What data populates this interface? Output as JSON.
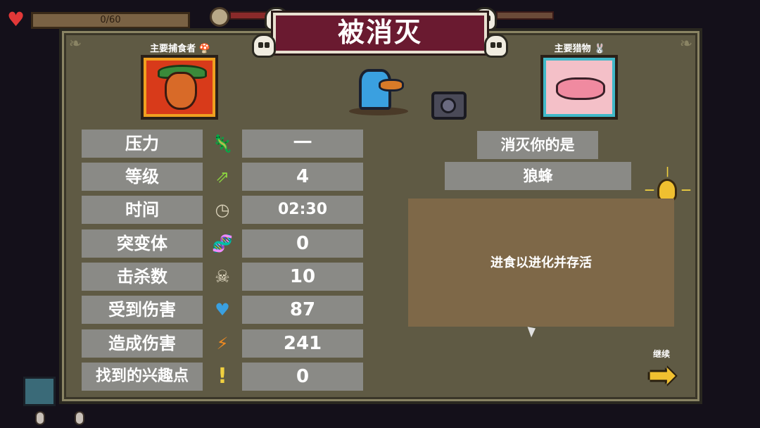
{
  "hud": {
    "health_text": "0/60",
    "heart_icon": "heart-icon"
  },
  "title": "被消灭",
  "predator": {
    "label": "主要捕食者 🍄",
    "icon": "mushroom-icon"
  },
  "prey": {
    "label": "主要猎物 🐰",
    "icon": "rabbit-icon"
  },
  "stats": [
    {
      "label": "压力",
      "icon": "axolotl-icon",
      "icon_glyph": "🦎",
      "value": "一"
    },
    {
      "label": "等级",
      "icon": "level-up-icon",
      "icon_glyph": "⇗",
      "value": "4"
    },
    {
      "label": "时间",
      "icon": "clock-icon",
      "icon_glyph": "◷",
      "value": "02:30"
    },
    {
      "label": "突变体",
      "icon": "dna-icon",
      "icon_glyph": "🧬",
      "value": "0"
    },
    {
      "label": "击杀数",
      "icon": "skull-icon",
      "icon_glyph": "☠",
      "value": "10"
    },
    {
      "label": "受到伤害",
      "icon": "heart-icon",
      "icon_glyph": "♥",
      "value": "87"
    },
    {
      "label": "造成伤害",
      "icon": "claw-icon",
      "icon_glyph": "⚡",
      "value": "241"
    },
    {
      "label": "找到的兴趣点",
      "icon": "exclamation-icon",
      "icon_glyph": "!",
      "value": "0"
    }
  ],
  "killer": {
    "title": "消灭你的是",
    "name": "狼蜂"
  },
  "tip": {
    "text": "进食以进化并存活"
  },
  "continue": {
    "label": "继续"
  },
  "colors": {
    "panel": "#5f5a44",
    "banner": "#6a1a30",
    "stat_box": "#8a8a86",
    "tip_box": "#7e6848",
    "arrow": "#f0c030"
  }
}
